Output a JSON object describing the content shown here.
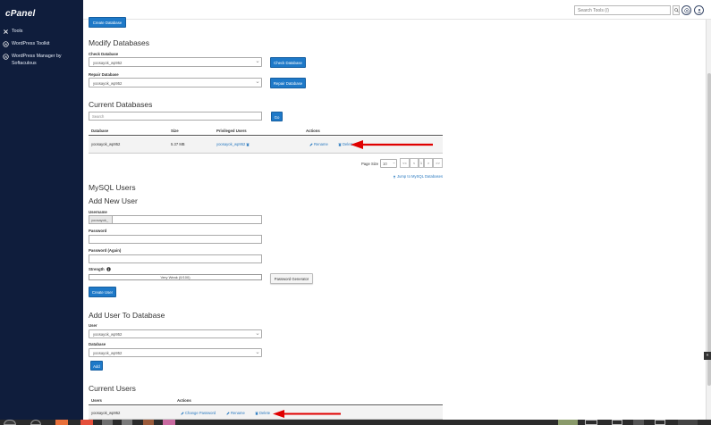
{
  "sidebar": {
    "logo": "cPanel",
    "items": [
      {
        "label": "Tools",
        "icon": "tools-icon"
      },
      {
        "label": "WordPress Toolkit",
        "icon": "wordpress-icon"
      },
      {
        "label": "WordPress Manager by Softaculous",
        "icon": "wordpress-icon"
      }
    ]
  },
  "header": {
    "search_placeholder": "Search Tools (/)",
    "search_icon": "search-icon",
    "help_icon": "help-icon",
    "user_icon": "user-icon"
  },
  "create_database": {
    "button_label": "Create Database"
  },
  "modify": {
    "title": "Modify Databases",
    "check_label": "Check Database",
    "check_value": "yoosayok_wp952",
    "check_button": "Check Database",
    "repair_label": "Repair Database",
    "repair_value": "yoosayok_wp952",
    "repair_button": "Repair Database"
  },
  "current_databases": {
    "title": "Current Databases",
    "search_placeholder": "Search",
    "go_button": "Go",
    "columns": [
      "Database",
      "Size",
      "Privileged Users",
      "Actions"
    ],
    "rows": [
      {
        "database": "yoosayok_wp952",
        "size": "5.37 MB",
        "user": "yoosayok_wp952",
        "rename": "Rename",
        "delete": "Delete"
      }
    ],
    "page_size_label": "Page Size",
    "page_size_value": "10",
    "pager": [
      "<<",
      "<",
      "1",
      ">",
      ">>"
    ],
    "jump_link": "Jump to MySQL Databases"
  },
  "mysql_users": {
    "title": "MySQL Users",
    "add_title": "Add New User",
    "username_label": "Username",
    "username_prefix": "yoosayok_",
    "password_label": "Password",
    "password_again_label": "Password (Again)",
    "strength_label": "Strength",
    "strength_value": "Very Weak (0/100)",
    "password_generator": "Password Generator",
    "create_user_button": "Create User"
  },
  "add_user_db": {
    "title": "Add User To Database",
    "user_label": "User",
    "user_value": "yoosayok_wp952",
    "database_label": "Database",
    "database_value": "yoosayok_wp952",
    "add_button": "Add"
  },
  "current_users": {
    "title": "Current Users",
    "columns": [
      "Users",
      "Actions"
    ],
    "rows": [
      {
        "user": "yoosayok_wp952",
        "change_password": "Change Password",
        "rename": "Rename",
        "delete": "Delete"
      }
    ]
  },
  "colors": {
    "sidebar_bg": "#0f1d3c",
    "primary_button": "#1e79c8",
    "link": "#2a7ac0",
    "arrow": "#e00000"
  }
}
